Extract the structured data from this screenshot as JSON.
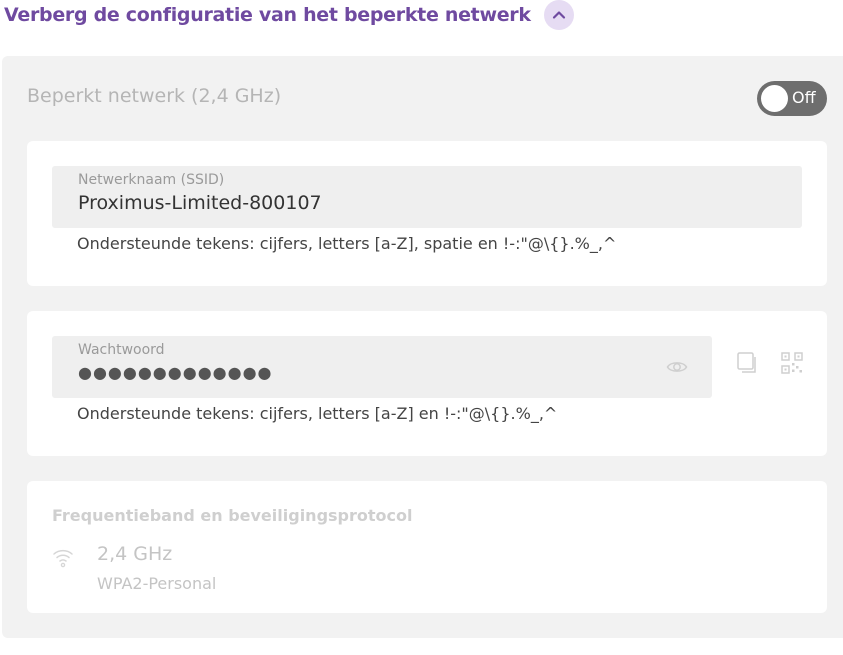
{
  "header": {
    "title": "Verberg de configuratie van het beperkte netwerk",
    "collapse_icon": "chevron-up-icon"
  },
  "network": {
    "title": "Beperkt netwerk (2,4 GHz)",
    "toggle_state": "Off"
  },
  "ssid": {
    "label": "Netwerknaam (SSID)",
    "value": "Proximus-Limited-800107",
    "hint": "Ondersteunde tekens: cijfers, letters [a-Z], spatie en !-:\"@\\{}.%_,^"
  },
  "password": {
    "label": "Wachtwoord",
    "masked_value": "●●●●●●●●●●●●●",
    "hint": "Ondersteunde tekens: cijfers, letters [a-Z] en !-:\"@\\{}.%_,^",
    "reveal_icon": "eye-icon",
    "copy_icon": "copy-icon",
    "qr_icon": "qr-code-icon"
  },
  "frequency": {
    "title": "Frequentieband en beveiligingsprotocol",
    "band": "2,4 GHz",
    "protocol": "WPA2-Personal",
    "icon": "wifi-icon"
  },
  "colors": {
    "accent": "#6f4aa0",
    "accent_light": "#e6dcf3",
    "toggle_off": "#6e6e6e",
    "panel_bg": "#f2f2f2"
  }
}
